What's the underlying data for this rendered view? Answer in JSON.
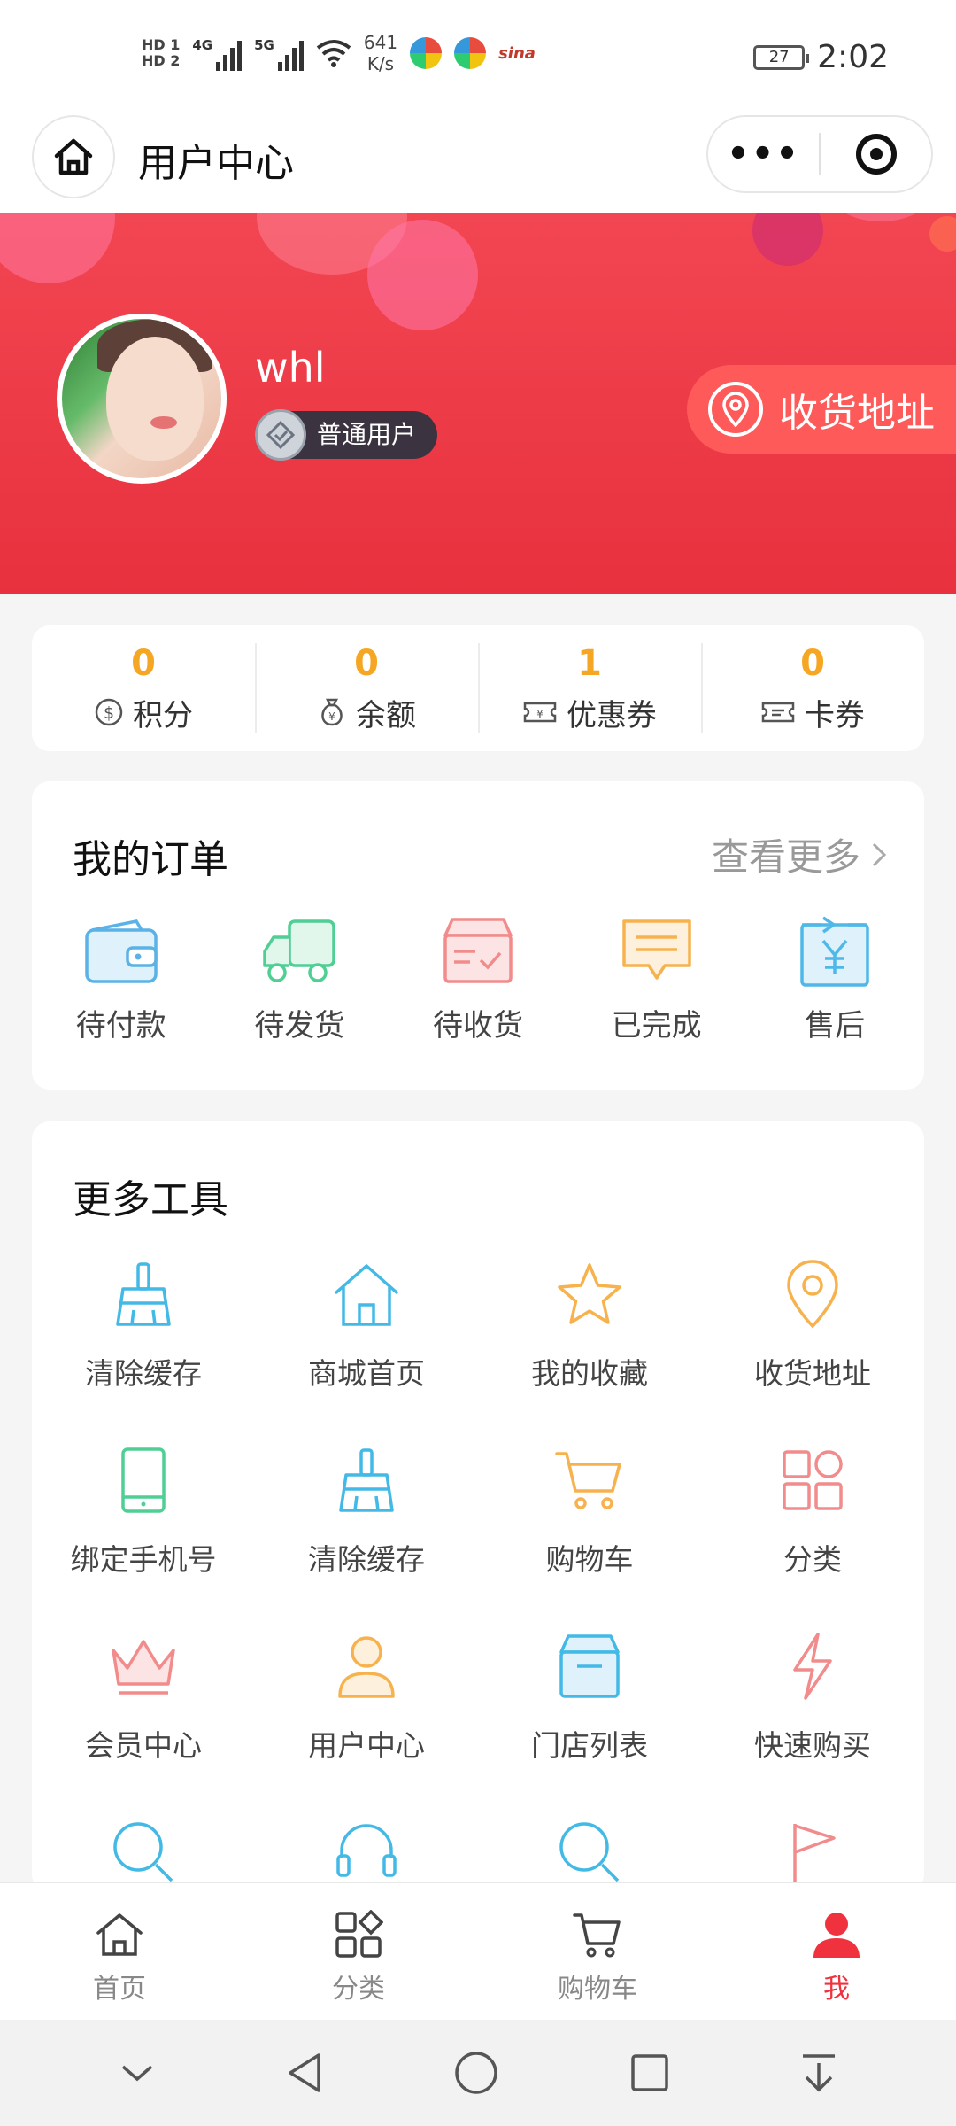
{
  "status_bar": {
    "speed_top": "641",
    "speed_bottom": "K/s",
    "network_1": "4G",
    "network_2": "5G",
    "hd_1": "HD 1",
    "hd_2": "HD 2",
    "battery": "27",
    "time": "2:02",
    "sina": "sina"
  },
  "nav": {
    "title": "用户中心"
  },
  "profile": {
    "username": "whl",
    "role": "普通用户",
    "address_button": "收货地址"
  },
  "stats": [
    {
      "value": "0",
      "label": "积分",
      "icon": "dollar-coin-icon"
    },
    {
      "value": "0",
      "label": "余额",
      "icon": "money-bag-icon"
    },
    {
      "value": "1",
      "label": "优惠券",
      "icon": "coupon-icon"
    },
    {
      "value": "0",
      "label": "卡券",
      "icon": "card-ticket-icon"
    }
  ],
  "orders": {
    "title": "我的订单",
    "more": "查看更多",
    "items": [
      {
        "label": "待付款",
        "icon": "wallet-icon",
        "color": "#5ab2e6"
      },
      {
        "label": "待发货",
        "icon": "truck-icon",
        "color": "#4fcf93"
      },
      {
        "label": "待收货",
        "icon": "box-check-icon",
        "color": "#f28b8b"
      },
      {
        "label": "已完成",
        "icon": "message-icon",
        "color": "#f7b24e"
      },
      {
        "label": "售后",
        "icon": "refund-icon",
        "color": "#4fb8e8"
      }
    ]
  },
  "tools": {
    "title": "更多工具",
    "items": [
      {
        "label": "清除缓存",
        "icon": "broom-icon",
        "color": "#43b9e6"
      },
      {
        "label": "商城首页",
        "icon": "home-icon",
        "color": "#43b9e6"
      },
      {
        "label": "我的收藏",
        "icon": "star-icon",
        "color": "#f7b24e"
      },
      {
        "label": "收货地址",
        "icon": "location-pin-icon",
        "color": "#f7b24e"
      },
      {
        "label": "绑定手机号",
        "icon": "phone-icon",
        "color": "#4fcf93"
      },
      {
        "label": "清除缓存",
        "icon": "broom-icon",
        "color": "#43b9e6"
      },
      {
        "label": "购物车",
        "icon": "cart-icon",
        "color": "#f7b24e"
      },
      {
        "label": "分类",
        "icon": "category-icon",
        "color": "#f28b8b"
      },
      {
        "label": "会员中心",
        "icon": "crown-icon",
        "color": "#f28b8b"
      },
      {
        "label": "用户中心",
        "icon": "user-icon",
        "color": "#f7b24e"
      },
      {
        "label": "门店列表",
        "icon": "store-icon",
        "color": "#43b9e6"
      },
      {
        "label": "快速购买",
        "icon": "lightning-icon",
        "color": "#f28b8b"
      }
    ]
  },
  "tabbar": [
    {
      "label": "首页",
      "icon": "home-icon",
      "active": false
    },
    {
      "label": "分类",
      "icon": "category-icon",
      "active": false
    },
    {
      "label": "购物车",
      "icon": "cart-icon",
      "active": false
    },
    {
      "label": "我",
      "icon": "user-icon",
      "active": true
    }
  ],
  "colors": {
    "brand_red": "#f0313e",
    "stat_orange": "#f5a623"
  }
}
